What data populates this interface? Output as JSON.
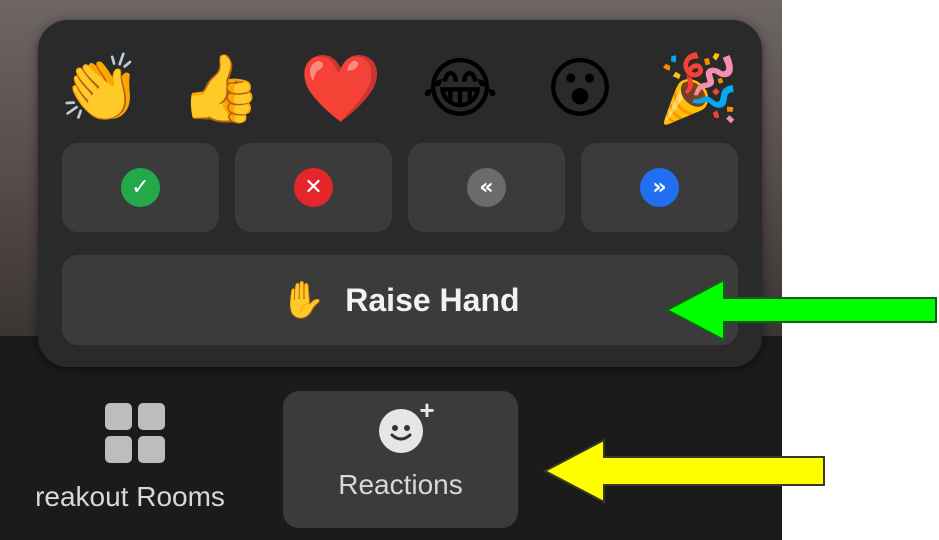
{
  "reactions": {
    "emojis": [
      {
        "name": "clapping-hands-emoji",
        "glyph": "👏"
      },
      {
        "name": "thumbs-up-emoji",
        "glyph": "👍"
      },
      {
        "name": "heart-emoji",
        "glyph": "❤️"
      },
      {
        "name": "tears-of-joy-emoji",
        "glyph": "😂"
      },
      {
        "name": "surprised-emoji",
        "glyph": "😮"
      },
      {
        "name": "party-popper-emoji",
        "glyph": "🎉"
      }
    ],
    "tiles": [
      {
        "name": "yes-icon",
        "glyph": "✓",
        "color": "#23a84a"
      },
      {
        "name": "no-icon",
        "glyph": "✕",
        "color": "#e5262b"
      },
      {
        "name": "slower-icon",
        "glyph": "«",
        "color": "#6b6b6b"
      },
      {
        "name": "faster-icon",
        "glyph": "»",
        "color": "#1f6ff0"
      }
    ],
    "raise_hand": {
      "icon": "✋",
      "label": "Raise Hand"
    }
  },
  "toolbar": {
    "breakout_rooms_label": "reakout Rooms",
    "reactions_label": "Reactions"
  },
  "annotations": {
    "green_arrow_color": "#00ff00",
    "yellow_arrow_color": "#ffff00"
  }
}
